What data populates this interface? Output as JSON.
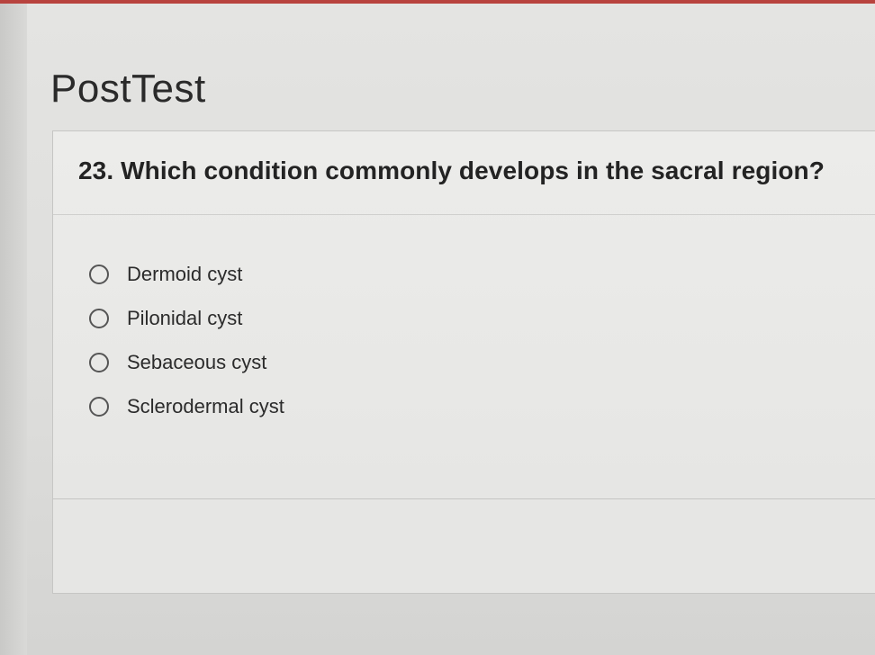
{
  "header": {
    "title": "PostTest"
  },
  "question": {
    "text": "23. Which condition commonly develops in the sacral region?",
    "options": [
      {
        "label": "Dermoid cyst",
        "selected": false
      },
      {
        "label": "Pilonidal cyst",
        "selected": false
      },
      {
        "label": "Sebaceous cyst",
        "selected": false
      },
      {
        "label": "Sclerodermal cyst",
        "selected": false
      }
    ]
  },
  "colors": {
    "accent_bar": "#b8433e",
    "text": "#232323",
    "radio_border": "#555555"
  }
}
